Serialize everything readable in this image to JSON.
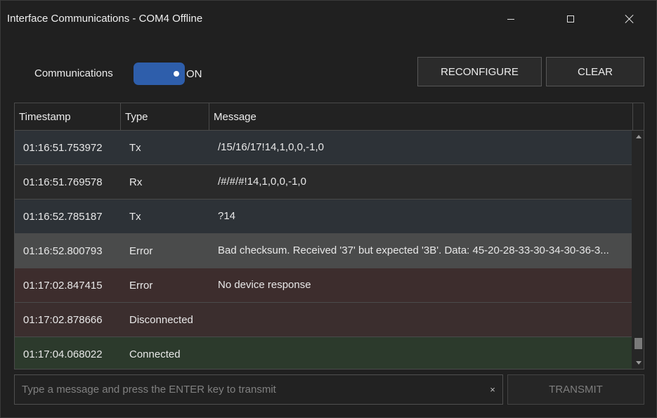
{
  "window": {
    "title": "Interface Communications - COM4 Offline",
    "close_glyph": "×"
  },
  "controls": {
    "communications_label": "Communications",
    "toggle_state": "ON",
    "toggle_on": true,
    "reconfigure_label": "RECONFIGURE",
    "clear_label": "CLEAR"
  },
  "grid": {
    "columns": [
      "Timestamp",
      "Type",
      "Message"
    ],
    "rows": [
      {
        "timestamp": "01:16:51.753972",
        "type": "Tx",
        "message": "/15/16/17!14,1,0,0,-1,0"
      },
      {
        "timestamp": "01:16:51.769578",
        "type": "Rx",
        "message": "/#/#/#!14,1,0,0,-1,0"
      },
      {
        "timestamp": "01:16:52.785187",
        "type": "Tx",
        "message": "?14"
      },
      {
        "timestamp": "01:16:52.800793",
        "type": "Error",
        "message": "Bad checksum. Received '37' but expected '3B'. Data: 45-20-28-33-30-34-30-36-3..."
      },
      {
        "timestamp": "01:17:02.847415",
        "type": "Error",
        "message": "No device response"
      },
      {
        "timestamp": "01:17:02.878666",
        "type": "Disconnected",
        "message": ""
      },
      {
        "timestamp": "01:17:04.068022",
        "type": "Connected",
        "message": ""
      }
    ]
  },
  "input": {
    "value": "",
    "placeholder": "Type a message and press the ENTER key to transmit",
    "clear_glyph": "×"
  },
  "transmit_label": "TRANSMIT",
  "colors": {
    "accent": "#2e5eab",
    "row_tx": "#2d3237",
    "row_selected": "#4a4b4b",
    "row_error": "#3d2d2d",
    "row_connected": "#2c3a2c"
  }
}
